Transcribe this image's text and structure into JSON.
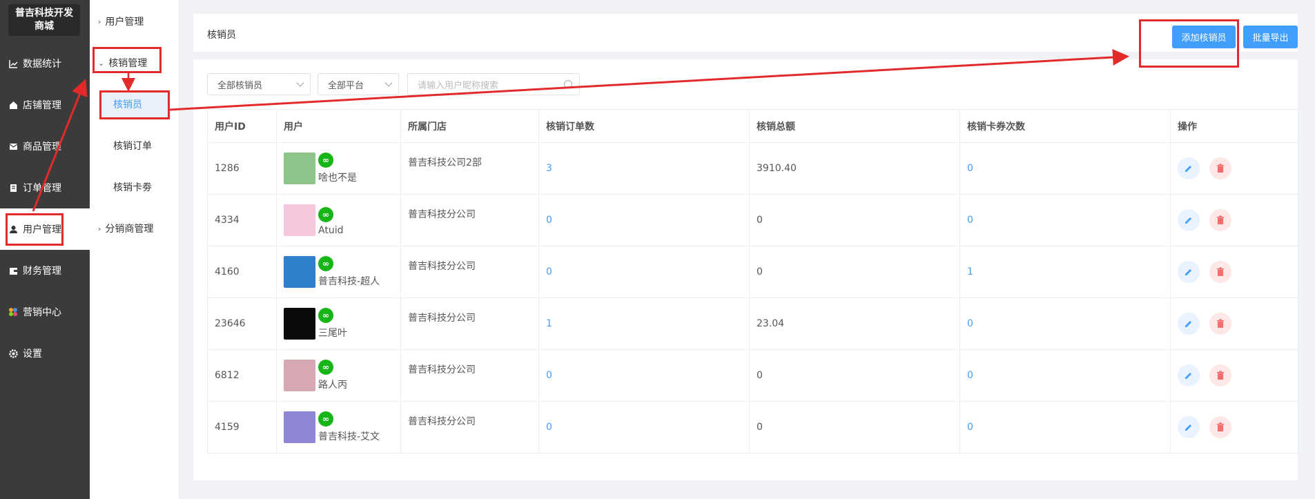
{
  "sidebar": {
    "logo": "普吉科技开发商城",
    "items": [
      {
        "label": "数据统计",
        "icon": "chart-line-icon"
      },
      {
        "label": "店铺管理",
        "icon": "store-icon"
      },
      {
        "label": "商品管理",
        "icon": "mail-icon"
      },
      {
        "label": "订单管理",
        "icon": "order-icon"
      },
      {
        "label": "用户管理",
        "icon": "user-icon"
      },
      {
        "label": "财务管理",
        "icon": "wallet-icon"
      },
      {
        "label": "营销中心",
        "icon": "marketing-icon"
      },
      {
        "label": "设置",
        "icon": "gear-icon"
      }
    ],
    "active_index": 4
  },
  "submenu": {
    "groups": [
      {
        "label": "用户管理"
      },
      {
        "label": "核销管理"
      },
      {
        "label": "分销商管理"
      }
    ],
    "items": [
      {
        "label": "核销员"
      },
      {
        "label": "核销订单"
      },
      {
        "label": "核销卡劵"
      }
    ]
  },
  "header": {
    "title": "核销员",
    "add_button": "添加核销员",
    "export_button": "批量导出"
  },
  "filters": {
    "verifier_select": "全部核销员",
    "platform_select": "全部平台",
    "search_placeholder": "请输入用户昵称搜索"
  },
  "table": {
    "headers": [
      "用户ID",
      "用户",
      "所属门店",
      "核销订单数",
      "核销总额",
      "核销卡券次数",
      "操作"
    ],
    "rows": [
      {
        "id": "1286",
        "name": "啥也不是",
        "shop": "普吉科技公司2部",
        "orders": "3",
        "total": "3910.40",
        "coupons": "0",
        "avatar_color": "#8cc68a"
      },
      {
        "id": "4334",
        "name": "Atuid",
        "shop": "普吉科技分公司",
        "orders": "0",
        "total": "0",
        "coupons": "0",
        "avatar_color": "#f6c6dc"
      },
      {
        "id": "4160",
        "name": "普吉科技-超人",
        "shop": "普吉科技分公司",
        "orders": "0",
        "total": "0",
        "coupons": "1",
        "avatar_color": "#2f7fc9"
      },
      {
        "id": "23646",
        "name": "三尾叶",
        "shop": "普吉科技分公司",
        "orders": "1",
        "total": "23.04",
        "coupons": "0",
        "avatar_color": "#0b0b0b"
      },
      {
        "id": "6812",
        "name": "路人丙",
        "shop": "普吉科技分公司",
        "orders": "0",
        "total": "0",
        "coupons": "0",
        "avatar_color": "#d8a7b4"
      },
      {
        "id": "4159",
        "name": "普吉科技-艾文",
        "shop": "普吉科技分公司",
        "orders": "0",
        "total": "0",
        "coupons": "0",
        "avatar_color": "#8e87d6"
      }
    ]
  },
  "colors": {
    "primary": "#409eff",
    "danger": "#f56c6c",
    "sidebar": "#3b3b3b",
    "annotation": "#e32a2a"
  }
}
